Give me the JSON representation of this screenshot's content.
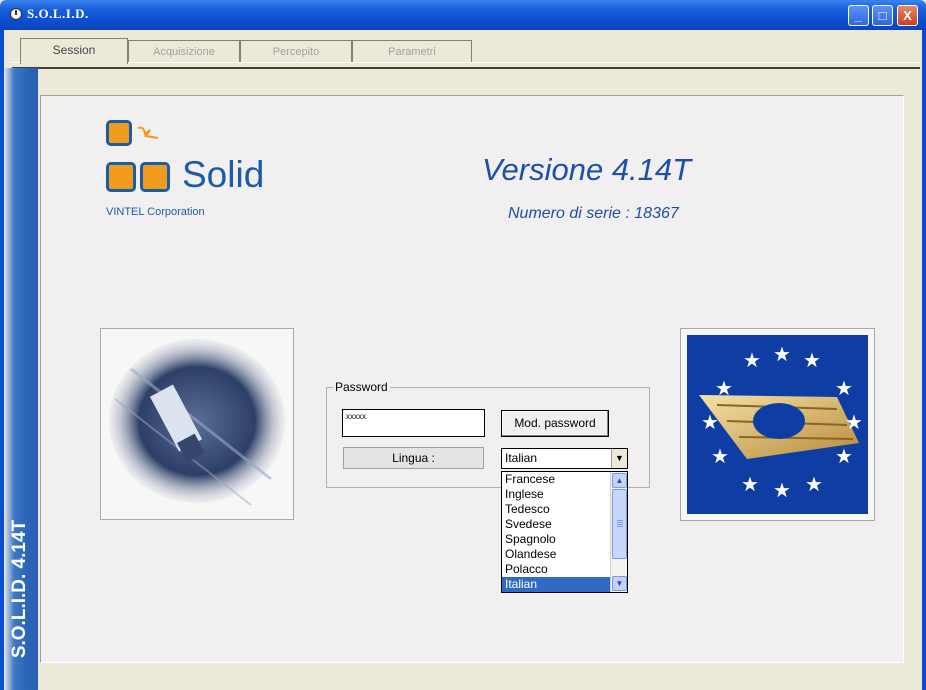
{
  "window": {
    "title": "S.O.L.I.D.",
    "min_symbol": "_",
    "max_symbol": "□",
    "close_symbol": "X"
  },
  "tabs": [
    {
      "label": "Session",
      "active": true
    },
    {
      "label": "Acquisizione",
      "active": false
    },
    {
      "label": "Percepito",
      "active": false
    },
    {
      "label": "Parametri",
      "active": false
    }
  ],
  "sidebar": {
    "vertical_text": "S.O.L.I.D. 4.14T"
  },
  "logo": {
    "word": "Solid",
    "subtitle": "VINTEL Corporation"
  },
  "version": {
    "title": "Versione 4.14T",
    "serial": "Numero di serie : 18367"
  },
  "password_group": {
    "label": "Password",
    "password_value": "xxxxx",
    "mod_button": "Mod. password",
    "lingua_label": "Lingua :",
    "language_selected": "Italian",
    "language_options": [
      "Francese",
      "Inglese",
      "Tedesco",
      "Svedese",
      "Spagnolo",
      "Olandese",
      "Polacco",
      "Italian"
    ]
  },
  "icons": {
    "app": "clock-icon",
    "truck_image": "truck-image",
    "eu_image": "eu-smartcard-image"
  },
  "colors": {
    "titlebar": "#0a4ed0",
    "brand_blue": "#1a5ca8",
    "brand_orange": "#f29a1b",
    "eu_blue": "#0e3ea3",
    "selection": "#316ac5"
  }
}
